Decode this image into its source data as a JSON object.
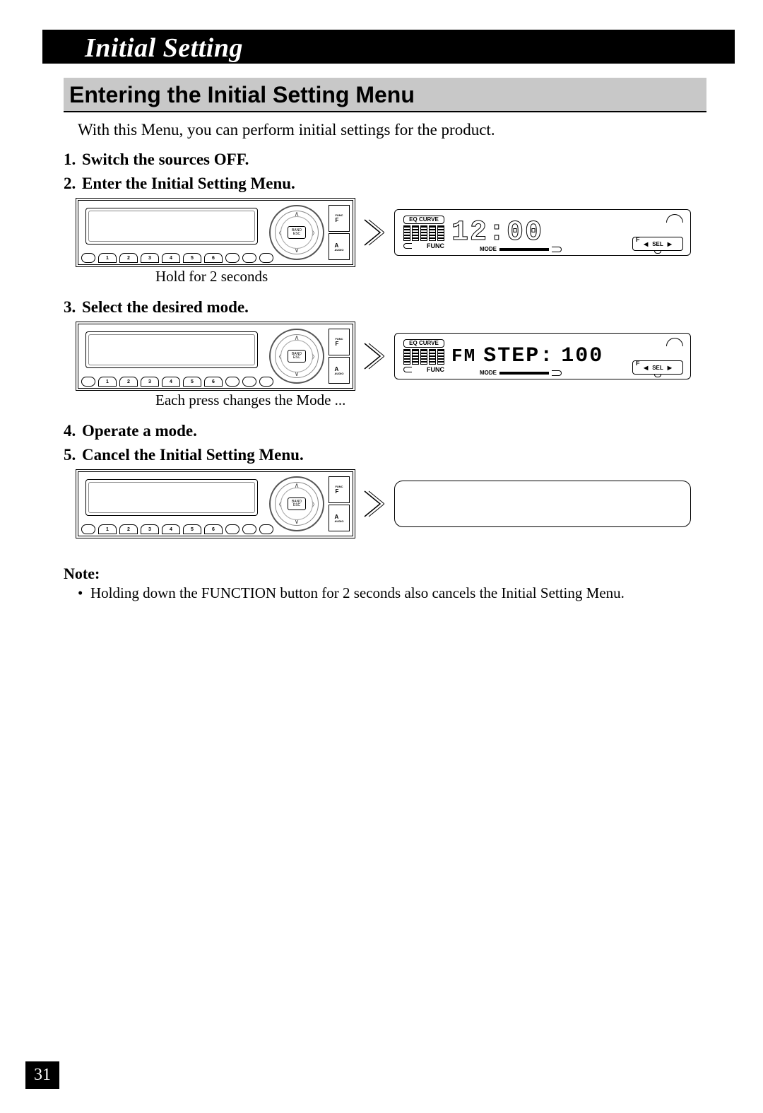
{
  "page": {
    "header_title": "Initial Setting",
    "section_heading": "Entering the Initial Setting Menu",
    "intro": "With this Menu, you can perform initial settings for the product.",
    "page_number": "31"
  },
  "steps": {
    "s1": {
      "num": "1.",
      "text": "Switch the sources OFF."
    },
    "s2": {
      "num": "2.",
      "text": "Enter the Initial Setting Menu.",
      "caption": "Hold for 2 seconds"
    },
    "s3": {
      "num": "3.",
      "text": "Select the desired mode.",
      "caption": "Each press changes the Mode ..."
    },
    "s4": {
      "num": "4.",
      "text": "Operate a mode."
    },
    "s5": {
      "num": "5.",
      "text": "Cancel the Initial Setting Menu."
    }
  },
  "unit": {
    "dial_center": "BAND ESC",
    "side": {
      "top_tiny": "FUNC",
      "top": "F",
      "bot": "A",
      "bot_tiny": "AUDIO"
    },
    "presets": [
      "1",
      "2",
      "3",
      "4",
      "5",
      "6"
    ]
  },
  "lcd": {
    "eq_label": "EQ CURVE",
    "func_label": "FUNC",
    "mode_label": "MODE",
    "sel_label": "SEL",
    "sel_f": "F",
    "panel2_clock": "12:00",
    "panel3_text_a": "FM",
    "panel3_text_b": "STEP:",
    "panel3_text_c": "100"
  },
  "note": {
    "label": "Note:",
    "item1": "Holding down the FUNCTION button for 2 seconds also cancels the Initial Setting Menu."
  }
}
